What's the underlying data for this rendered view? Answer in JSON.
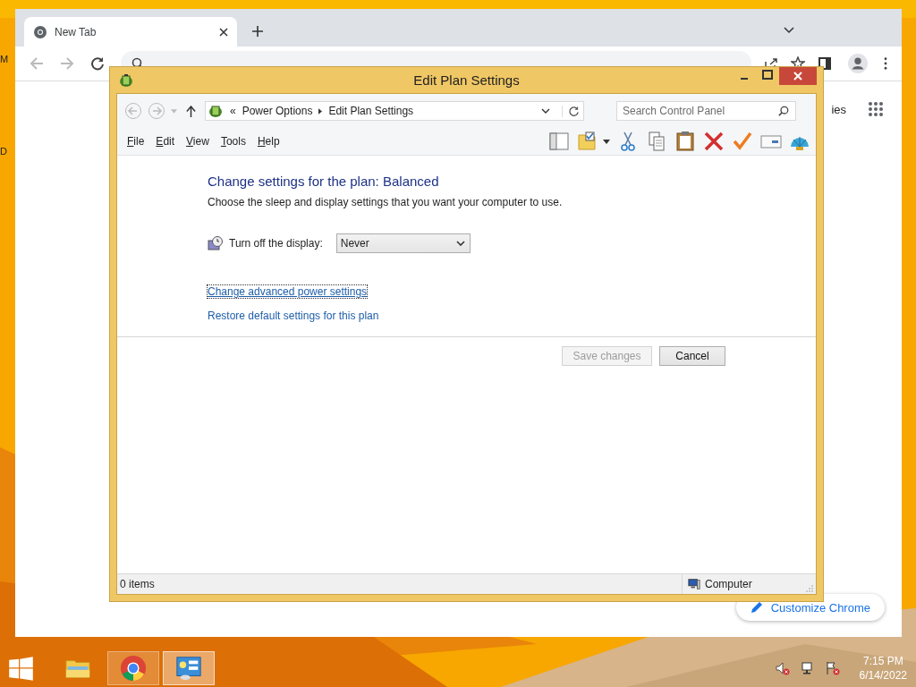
{
  "desktop": {
    "icon_labels": [
      "M",
      "D"
    ]
  },
  "browser": {
    "tab": {
      "title": "New Tab",
      "selected": true
    },
    "link_fragment": "ies",
    "customize_button": "Customize Chrome"
  },
  "dialog": {
    "title": "Edit Plan Settings",
    "breadcrumb_prefix": "«",
    "breadcrumb": [
      "Power Options",
      "Edit Plan Settings"
    ],
    "search": {
      "placeholder": "Search Control Panel"
    },
    "menu": [
      "File",
      "Edit",
      "View",
      "Tools",
      "Help"
    ],
    "heading": "Change settings for the plan: Balanced",
    "description": "Choose the sleep and display settings that you want your computer to use.",
    "settings": [
      {
        "label": "Turn off the display:",
        "value": "Never"
      }
    ],
    "links": [
      {
        "text": "Change advanced power settings",
        "focused": true
      },
      {
        "text": "Restore default settings for this plan",
        "focused": false
      }
    ],
    "buttons": [
      {
        "label": "Save changes",
        "disabled": true
      },
      {
        "label": "Cancel",
        "disabled": false
      }
    ],
    "status_bar": {
      "items": "0 items",
      "location": "Computer"
    }
  },
  "taskbar": {
    "apps": [
      {
        "kind": "explorer",
        "selected": false
      },
      {
        "kind": "chrome",
        "selected": false
      },
      {
        "kind": "control-panel",
        "selected": true
      }
    ],
    "time": "7:15 PM",
    "date": "6/14/2022"
  }
}
